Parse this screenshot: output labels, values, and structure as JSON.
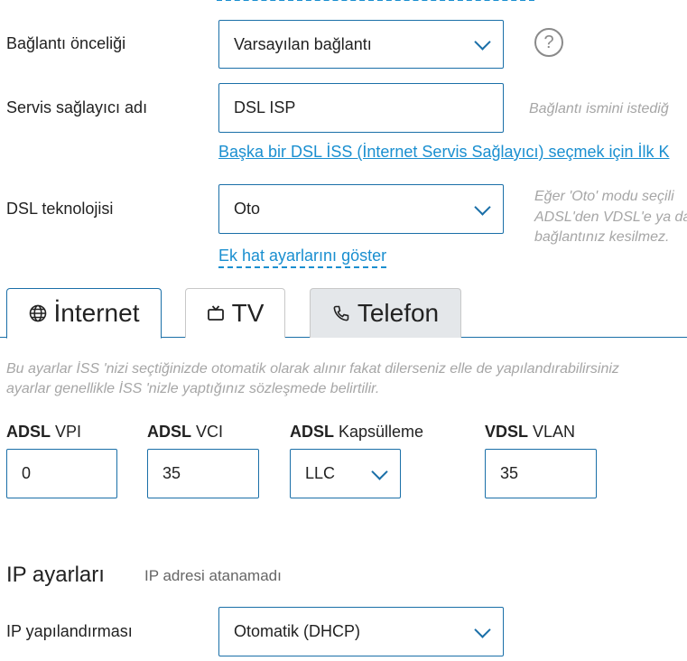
{
  "connection": {
    "priority_label": "Bağlantı önceliği",
    "priority_value": "Varsayılan bağlantı",
    "provider_label": "Servis sağlayıcı adı",
    "provider_value": "DSL ISP",
    "provider_hint": "Bağlantı ismini istediğ",
    "provider_link": "Başka bir DSL İSS (İnternet Servis Sağlayıcı) seçmek için İlk K",
    "tech_label": "DSL teknolojisi",
    "tech_value": "Oto",
    "tech_hint_1": "Eğer 'Oto' modu seçili",
    "tech_hint_2": "ADSL'den VDSL'e ya da",
    "tech_hint_3": "bağlantınız kesilmez.",
    "extra_link": "Ek hat ayarlarını göster"
  },
  "tabs": [
    {
      "label": "İnternet",
      "icon": "globe-icon",
      "active": true
    },
    {
      "label": "TV",
      "icon": "tv-icon",
      "active": false
    },
    {
      "label": "Telefon",
      "icon": "phone-icon",
      "active": false
    }
  ],
  "internet": {
    "note_1": "Bu ayarlar İSS 'nizi seçtiğinizde otomatik olarak alınır fakat dilerseniz elle de yapılandırabilirsiniz",
    "note_2": "ayarlar genellikle İSS 'nizle yaptığınız sözleşmede belirtilir.",
    "vpi_bold": "ADSL",
    "vpi_label": " VPI",
    "vpi_value": "0",
    "vci_bold": "ADSL",
    "vci_label": " VCI",
    "vci_value": "35",
    "encap_bold": "ADSL",
    "encap_label": " Kapsülleme",
    "encap_value": "LLC",
    "vlan_bold": "VDSL",
    "vlan_label": " VLAN",
    "vlan_value": "35"
  },
  "ip": {
    "title": "IP ayarları",
    "status": "IP adresi atanamadı",
    "config_label": "IP yapılandırması",
    "config_value": "Otomatik (DHCP)"
  },
  "help_symbol": "?",
  "colors": {
    "accent": "#1a8fd0",
    "border": "#1a6fa8",
    "hint": "#a6a6a6",
    "tab_inactive": "#e4e7ea"
  }
}
